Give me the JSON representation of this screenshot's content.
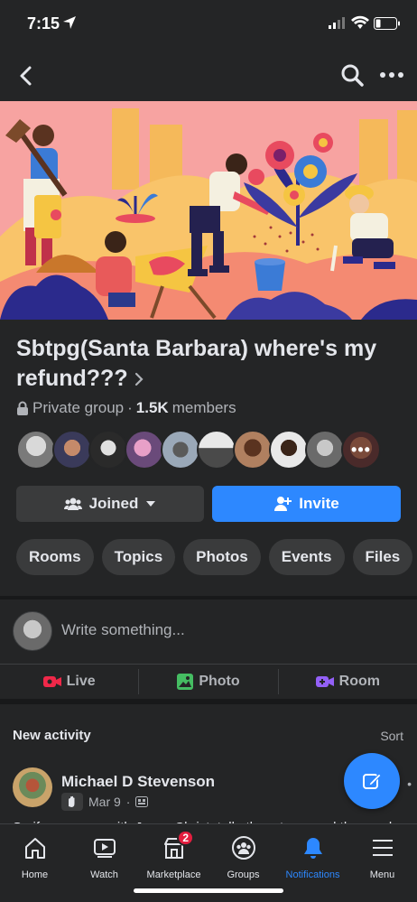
{
  "status_bar": {
    "time": "7:15"
  },
  "group": {
    "name": "Sbtpg(Santa Barbara) where's my refund???",
    "privacy": "Private group",
    "separator": "·",
    "member_count": "1.5K",
    "members_label": "members",
    "members_more": "•••"
  },
  "buttons": {
    "joined": "Joined",
    "invite": "Invite"
  },
  "chips": [
    "Rooms",
    "Topics",
    "Photos",
    "Events",
    "Files"
  ],
  "composer": {
    "placeholder": "Write something...",
    "actions": {
      "live": "Live",
      "photo": "Photo",
      "room": "Room"
    }
  },
  "activity": {
    "heading": "New activity",
    "sort": "Sort",
    "post": {
      "author": "Michael D Stevenson",
      "date": "Mar 9",
      "separator": "·",
      "more": "•",
      "text": "So if you agree with Jesus Christ, tell others to spread the word"
    }
  },
  "tabbar": {
    "home": "Home",
    "watch": "Watch",
    "marketplace": "Marketplace",
    "marketplace_badge": "2",
    "groups": "Groups",
    "notifications": "Notifications",
    "menu": "Menu"
  },
  "colors": {
    "background": "#18191a",
    "surface": "#242526",
    "accent": "#2d88ff",
    "badge": "#e41e3f",
    "live": "#f02849",
    "photo": "#45bd62",
    "room": "#9360f7"
  }
}
